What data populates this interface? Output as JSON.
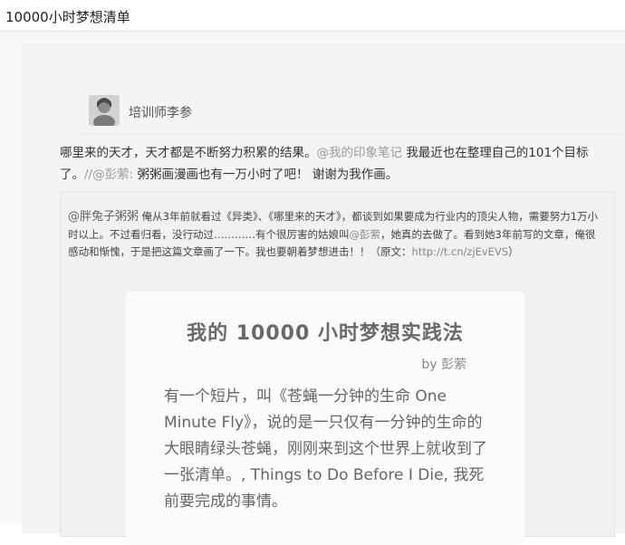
{
  "page": {
    "title": "10000小时梦想清单"
  },
  "post": {
    "author": "培训师李参",
    "text_main": "哪里来的天才，天才都是不断努力积累的结果。",
    "mention_evernote": "@我的印象笔记",
    "text_after_mention": " 我最近也在整理自己的101个目标了。",
    "mention_pengyi": "//@彭萦:",
    "text_end": " 粥粥画漫画也有一万小时了吧！ 谢谢为我作画。"
  },
  "repost": {
    "author": "@胖兔子粥粥",
    "text": " 俺从3年前就看过《异类》、《哪里来的天才》，都谈到如果要成为行业内的顶尖人物，需要努力1万小时以上。不过看归看，没行动过…………有个很厉害的姑娘叫",
    "mention": "@彭萦",
    "text2": "，她真的去做了。看到她3年前写的文章，俺很感动和惭愧，于是把这篇文章画了一下。我也要朝着梦想进击！！（原文：",
    "link": "http://t.cn/zjEvEVS",
    "text3": "）"
  },
  "image": {
    "title": "我的 10000 小时梦想实践法",
    "byline": "by 彭萦",
    "body": "有一个短片，叫《苍蝇一分钟的生命 One Minute Fly》，说的是一只仅有一分钟的生命的大眼睛绿头苍蝇，刚刚来到这个世界上就收到了一张清单。, Things to Do Before I Die, 我死前要完成的事情。"
  }
}
